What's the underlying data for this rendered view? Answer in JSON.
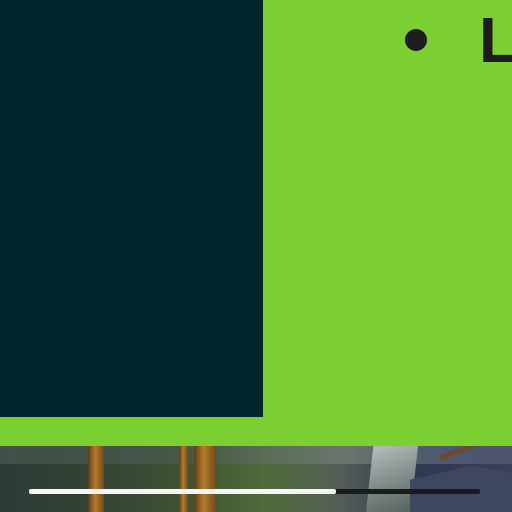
{
  "colors": {
    "background_green": "#7ccf31",
    "dark_panel": "#00252b",
    "bullet_text": "#1c1c1c",
    "progress_fill": "#f5f5f5",
    "progress_track": "#1b1b1b"
  },
  "slide": {
    "bullet_text": "L"
  },
  "video_player": {
    "progress_fraction": 0.68
  }
}
